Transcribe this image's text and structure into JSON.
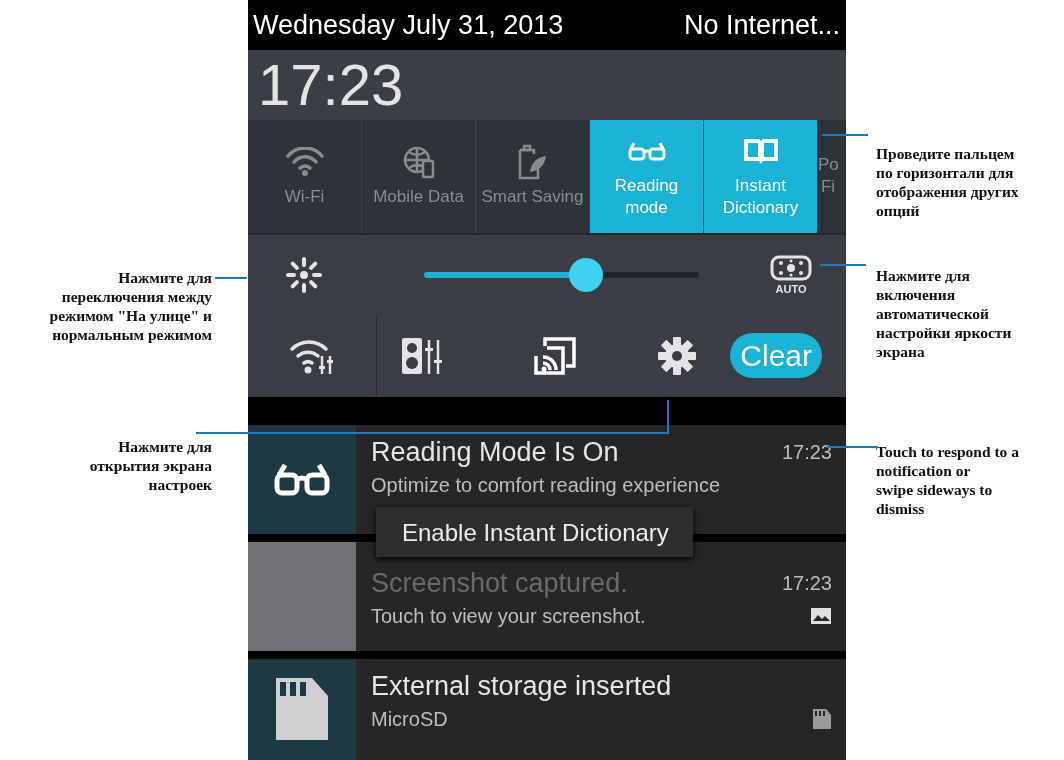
{
  "status_bar": {
    "date": "Wednesday July 31, 2013",
    "network": "No Internet..."
  },
  "clock": "17:23",
  "tiles": [
    {
      "kind": "wifi",
      "label": "Wi-Fi",
      "selected": false
    },
    {
      "kind": "mobile-data",
      "label": "Mobile Data",
      "selected": false
    },
    {
      "kind": "smart-saving",
      "label": "Smart Saving",
      "selected": false
    },
    {
      "kind": "reading",
      "label": "Reading mode",
      "selected": true
    },
    {
      "kind": "dictionary",
      "label": "Instant Dictionary",
      "selected": true
    },
    {
      "kind": "partial",
      "label": "Po Fi",
      "selected": false
    }
  ],
  "brightness": {
    "level": 0.59,
    "auto_label": "AUTO"
  },
  "actions": {
    "clear": "Clear"
  },
  "notifications": [
    {
      "kind": "reading",
      "title": "Reading Mode Is On",
      "text": "Optimize to comfort reading experience",
      "time": "17:23"
    },
    {
      "kind": "screenshot",
      "title": "Screenshot captured.",
      "text": "Touch to view your screenshot.",
      "time": "17:23"
    },
    {
      "kind": "storage",
      "title": "External storage inserted",
      "text": "MicroSD"
    }
  ],
  "toast": "Enable Instant Dictionary",
  "left_callouts": [
    {
      "text": "Нажмите для\nпереключения между\nрежимом \"На улице\" и\nнормальным режимом"
    },
    {
      "text": "Нажмите для\nоткрытия экрана\nнастроек"
    }
  ],
  "right_callouts": [
    {
      "text": "Проведите пальцем\nпо горизонтали для\nотображения других\nопций"
    },
    {
      "text": "Нажмите для\nвключения\nавтоматической\nнастройки яркости\nэкрана"
    },
    {
      "text": "Touch to respond to a\nnotification or\nswipe sideways to\ndismiss"
    }
  ]
}
